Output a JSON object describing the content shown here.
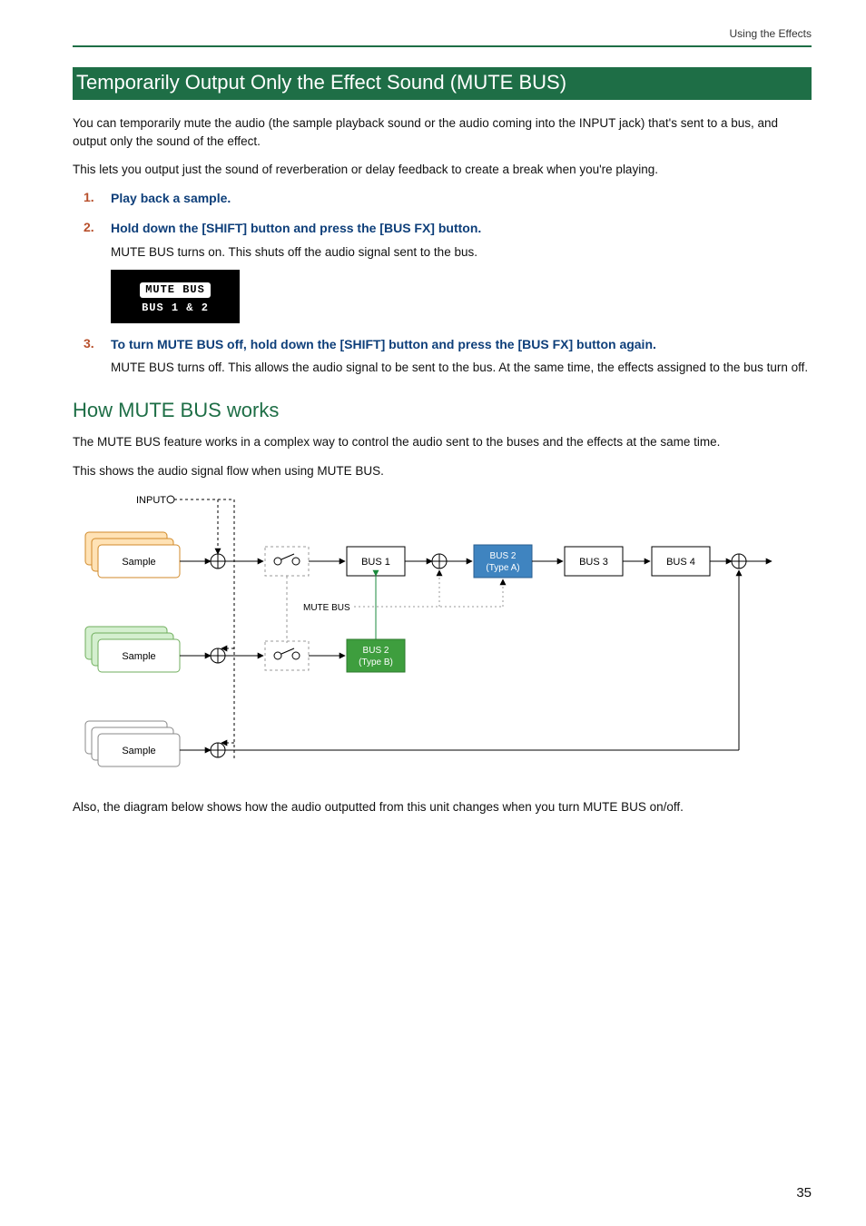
{
  "header": {
    "running": "Using the Effects"
  },
  "section": {
    "title": "Temporarily Output Only the Effect Sound (MUTE BUS)"
  },
  "intro": {
    "p1": "You can temporarily mute the audio (the sample playback sound or the audio coming into the INPUT jack) that's sent to a bus, and output only the sound of the effect.",
    "p2": "This lets you output just the sound of reverberation or delay feedback to create a break when you're playing."
  },
  "steps": [
    {
      "num": "1.",
      "head": "Play back a sample."
    },
    {
      "num": "2.",
      "head": "Hold down the [SHIFT] button and press the [BUS FX] button.",
      "body": "MUTE BUS turns on. This shuts off the audio signal sent to the bus.",
      "lcd": {
        "line1": "MUTE BUS",
        "line2": "BUS 1 & 2"
      }
    },
    {
      "num": "3.",
      "head": "To turn MUTE BUS off, hold down the [SHIFT] button and press the [BUS FX] button again.",
      "body": "MUTE BUS turns off. This allows the audio signal to be sent to the bus. At the same time, the effects assigned to the bus turn off."
    }
  ],
  "sub": {
    "title": "How MUTE BUS works"
  },
  "works": {
    "p1": "The MUTE BUS feature works in a complex way to control the audio sent to the buses and the effects at the same time.",
    "p2": "This shows the audio signal flow when using MUTE BUS.",
    "p3": "Also, the diagram below shows how the audio outputted from this unit changes when you turn MUTE BUS on/off."
  },
  "diagram": {
    "input": "INPUT",
    "sample": "Sample",
    "bus1": "BUS 1",
    "bus2a_l1": "BUS 2",
    "bus2a_l2": "(Type A)",
    "bus2b_l1": "BUS 2",
    "bus2b_l2": "(Type B)",
    "bus3": "BUS 3",
    "bus4": "BUS 4",
    "mutebus": "MUTE BUS"
  },
  "page": {
    "number": "35"
  },
  "chart_data": {
    "type": "flow",
    "title": "Audio signal flow when using MUTE BUS",
    "nodes": [
      {
        "id": "input",
        "label": "INPUT",
        "kind": "source"
      },
      {
        "id": "sampleA",
        "label": "Sample",
        "kind": "sample",
        "color": "orange"
      },
      {
        "id": "sampleB",
        "label": "Sample",
        "kind": "sample",
        "color": "green"
      },
      {
        "id": "sampleC",
        "label": "Sample",
        "kind": "sample",
        "color": "white"
      },
      {
        "id": "mix1",
        "label": "",
        "kind": "sum"
      },
      {
        "id": "mix2",
        "label": "",
        "kind": "sum"
      },
      {
        "id": "mix3",
        "label": "",
        "kind": "sum"
      },
      {
        "id": "sw1",
        "label": "",
        "kind": "switch"
      },
      {
        "id": "sw2",
        "label": "",
        "kind": "switch"
      },
      {
        "id": "mutebus",
        "label": "MUTE BUS",
        "kind": "control"
      },
      {
        "id": "bus1",
        "label": "BUS 1",
        "kind": "bus"
      },
      {
        "id": "bus2a",
        "label": "BUS 2 (Type A)",
        "kind": "bus"
      },
      {
        "id": "bus2b",
        "label": "BUS 2 (Type B)",
        "kind": "bus"
      },
      {
        "id": "bus3",
        "label": "BUS 3",
        "kind": "bus"
      },
      {
        "id": "bus4",
        "label": "BUS 4",
        "kind": "bus"
      },
      {
        "id": "mixA",
        "label": "",
        "kind": "sum"
      },
      {
        "id": "mixOut",
        "label": "",
        "kind": "sum"
      },
      {
        "id": "out",
        "label": "",
        "kind": "output"
      }
    ],
    "edges": [
      {
        "from": "input",
        "to": "mix1"
      },
      {
        "from": "sampleA",
        "to": "mix1"
      },
      {
        "from": "mix1",
        "to": "sw1"
      },
      {
        "from": "sw1",
        "to": "bus1"
      },
      {
        "from": "bus1",
        "to": "mixA"
      },
      {
        "from": "mixA",
        "to": "bus2a"
      },
      {
        "from": "bus2a",
        "to": "bus3"
      },
      {
        "from": "bus3",
        "to": "bus4"
      },
      {
        "from": "bus4",
        "to": "mixOut"
      },
      {
        "from": "mixOut",
        "to": "out"
      },
      {
        "from": "sampleB",
        "to": "mix2"
      },
      {
        "from": "mix2",
        "to": "sw2"
      },
      {
        "from": "sw2",
        "to": "bus2b"
      },
      {
        "from": "bus2b",
        "to": "bus2a",
        "feedback": true
      },
      {
        "from": "bus2b",
        "to": "mixA",
        "feedback": true
      },
      {
        "from": "sampleC",
        "to": "mix3"
      },
      {
        "from": "mix3",
        "to": "mixOut"
      },
      {
        "from": "mutebus",
        "to": "sw1",
        "control": true
      },
      {
        "from": "mutebus",
        "to": "sw2",
        "control": true
      }
    ]
  }
}
